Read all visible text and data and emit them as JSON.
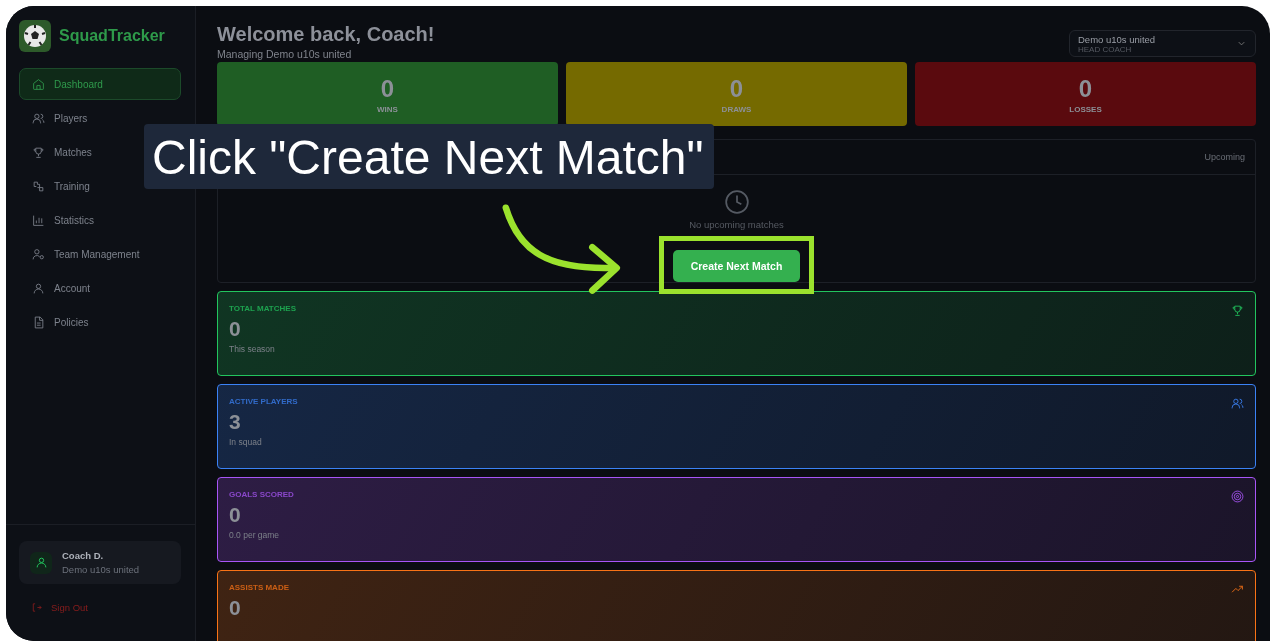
{
  "sidebar": {
    "brand": "SquadTracker",
    "items": [
      {
        "label": "Dashboard",
        "selected": true
      },
      {
        "label": "Players",
        "selected": false
      },
      {
        "label": "Matches",
        "selected": false
      },
      {
        "label": "Training",
        "selected": false
      },
      {
        "label": "Statistics",
        "selected": false
      },
      {
        "label": "Team Management",
        "selected": false
      },
      {
        "label": "Account",
        "selected": false
      },
      {
        "label": "Policies",
        "selected": false
      }
    ],
    "user": {
      "name": "Coach D.",
      "team": "Demo u10s united"
    },
    "sign_out": "Sign Out"
  },
  "header": {
    "title": "Welcome back, Coach!",
    "subtitle": "Managing Demo u10s united",
    "team_selector": {
      "team": "Demo u10s united",
      "role": "HEAD COACH"
    }
  },
  "record": [
    {
      "value": "0",
      "label": "WINS",
      "color": "#1f5e24"
    },
    {
      "value": "0",
      "label": "DRAWS",
      "color": "#756a00"
    },
    {
      "value": "0",
      "label": "LOSSES",
      "color": "#5a0a0e"
    }
  ],
  "upcoming": {
    "tag": "Upcoming",
    "empty_text": "No upcoming matches",
    "button": "Create Next Match"
  },
  "stats": [
    {
      "kind": "trophy",
      "label": "TOTAL MATCHES",
      "value": "0",
      "note": "This season",
      "color": "#22c55e"
    },
    {
      "kind": "users",
      "label": "ACTIVE PLAYERS",
      "value": "3",
      "note": "In squad",
      "color": "#3b82f6"
    },
    {
      "kind": "target",
      "label": "GOALS SCORED",
      "value": "0",
      "note": "0.0 per game",
      "color": "#a855f7"
    },
    {
      "kind": "trend",
      "label": "ASSISTS MADE",
      "value": "0",
      "color": "#f97316"
    }
  ],
  "callout": {
    "text": "Click \"Create Next Match\""
  }
}
